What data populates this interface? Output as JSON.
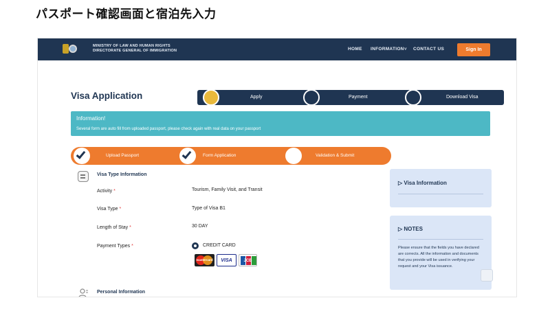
{
  "page": {
    "heading": "パスポート確認画面と宿泊先入力"
  },
  "nav": {
    "ministry_line1": "MINISTRY OF LAW AND HUMAN RIGHTS",
    "ministry_line2": "DIRECTORATE GENERAL OF IMMIGRATION",
    "links": [
      "HOME",
      "INFORMATION",
      "CONTACT US"
    ],
    "information_caret": "˅",
    "signin": "Sign In",
    "colors": {
      "bar": "#1f3552",
      "accent": "#ee7b2e"
    }
  },
  "header": {
    "title": "Visa Application",
    "steps": [
      "Apply",
      "Payment",
      "Download Visa"
    ],
    "active_step": "Apply"
  },
  "info": {
    "heading": "Information!",
    "text": "Several form are auto fill from uploaded passport, please check again with real data on your passport"
  },
  "progress": {
    "steps": [
      "Upload Passport",
      "Form Application",
      "Validation & Submit"
    ],
    "completed": [
      "Upload Passport",
      "Form Application"
    ]
  },
  "visa_type": {
    "section_title": "Visa Type Information",
    "required_mark": "*",
    "fields": [
      {
        "label": "Activity",
        "value": "Tourism, Family Visit, and Transit"
      },
      {
        "label": "Visa Type",
        "value": "Type of Visa B1"
      },
      {
        "label": "Length of Stay",
        "value": "30 DAY"
      },
      {
        "label": "Payment Types",
        "value": ""
      }
    ],
    "payment_option": "CREDIT CARD",
    "cards": [
      "mastercard",
      "VISA",
      "JCB"
    ]
  },
  "personal": {
    "section_title": "Personal Information"
  },
  "side": {
    "visa_info_title": "Visa Information",
    "notes_title": "NOTES",
    "notes_text": "Please ensure that the fields you have declared are corrects. All the information and documents that you provide will be used in verifying your request and your Visa issuance.",
    "caret": "▷"
  }
}
